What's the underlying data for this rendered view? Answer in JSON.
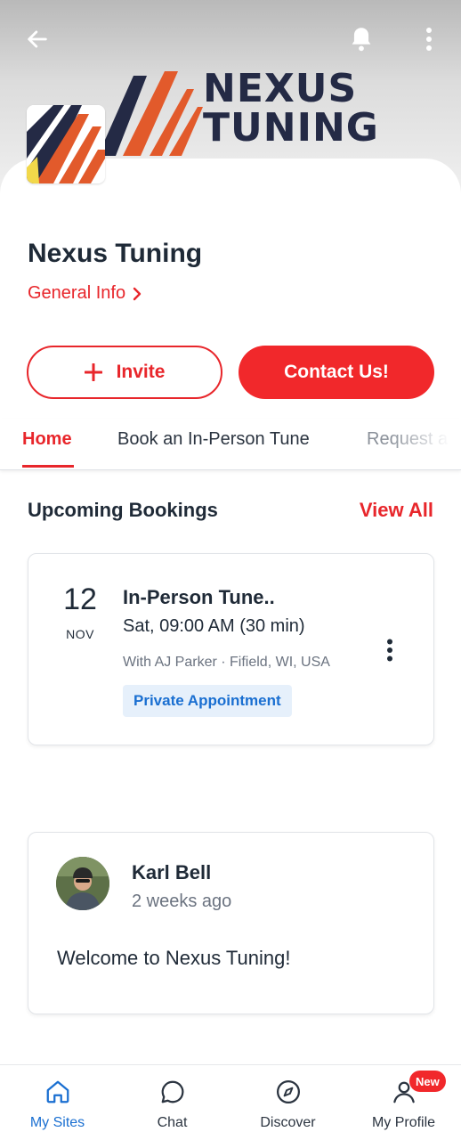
{
  "header": {
    "back_icon": "arrow-left-icon",
    "notification_icon": "bell-icon",
    "more_icon": "more-vertical-icon",
    "cover_brand_line1": "NEXUS",
    "cover_brand_line2": "TUNING",
    "brand_colors": {
      "navy": "#242a45",
      "orange": "#e25a2b",
      "yellow": "#f2d84a"
    }
  },
  "site": {
    "title": "Nexus Tuning",
    "general_info_label": "General Info"
  },
  "actions": {
    "invite_label": "Invite",
    "contact_label": "Contact Us!"
  },
  "tabs": [
    {
      "label": "Home",
      "active": true
    },
    {
      "label": "Book an In-Person Tune",
      "active": false
    },
    {
      "label": "Request a",
      "active": false
    }
  ],
  "bookings": {
    "section_title": "Upcoming Bookings",
    "view_all_label": "View All",
    "items": [
      {
        "day": "12",
        "month": "NOV",
        "title": "In-Person Tune..",
        "time": "Sat, 09:00 AM (30 min)",
        "details": "With AJ Parker · Fifield, WI, USA",
        "badge": "Private Appointment"
      }
    ]
  },
  "post": {
    "author": "Karl Bell",
    "time": "2 weeks ago",
    "body": "Welcome to Nexus Tuning!"
  },
  "bottom_nav": [
    {
      "label": "My Sites",
      "icon": "home-icon",
      "active": true
    },
    {
      "label": "Chat",
      "icon": "chat-bubble-icon",
      "active": false
    },
    {
      "label": "Discover",
      "icon": "compass-icon",
      "active": false
    },
    {
      "label": "My Profile",
      "icon": "user-icon",
      "active": false,
      "badge": "New"
    }
  ],
  "colors": {
    "accent_red": "#e8262b",
    "link_blue": "#1a6fd1",
    "badge_bg": "#e6f0fb"
  }
}
